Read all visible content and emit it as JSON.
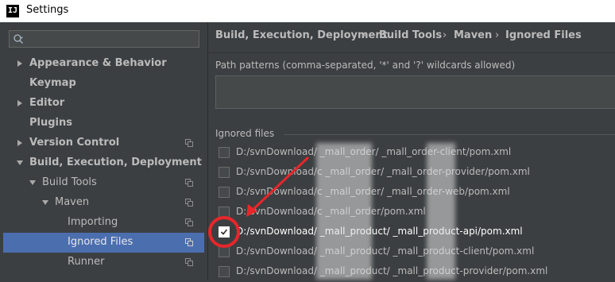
{
  "window": {
    "title": "Settings",
    "app_logo": "IJ"
  },
  "search": {
    "placeholder": "",
    "icon": "search-icon"
  },
  "tree": [
    {
      "label": "Appearance & Behavior",
      "bold": true,
      "arrow": "collapsed",
      "level": 0,
      "has_icon": false,
      "selected": false
    },
    {
      "label": "Keymap",
      "bold": true,
      "arrow": "none",
      "level": 0,
      "has_icon": false,
      "selected": false
    },
    {
      "label": "Editor",
      "bold": true,
      "arrow": "collapsed",
      "level": 0,
      "has_icon": false,
      "selected": false
    },
    {
      "label": "Plugins",
      "bold": true,
      "arrow": "none",
      "level": 0,
      "has_icon": false,
      "selected": false
    },
    {
      "label": "Version Control",
      "bold": true,
      "arrow": "collapsed",
      "level": 0,
      "has_icon": true,
      "selected": false
    },
    {
      "label": "Build, Execution, Deployment",
      "bold": true,
      "arrow": "expanded",
      "level": 0,
      "has_icon": false,
      "selected": false
    },
    {
      "label": "Build Tools",
      "bold": false,
      "arrow": "expanded",
      "level": 1,
      "has_icon": true,
      "selected": false
    },
    {
      "label": "Maven",
      "bold": false,
      "arrow": "expanded",
      "level": 2,
      "has_icon": true,
      "selected": false
    },
    {
      "label": "Importing",
      "bold": false,
      "arrow": "none",
      "level": 3,
      "has_icon": true,
      "selected": false
    },
    {
      "label": "Ignored Files",
      "bold": false,
      "arrow": "none",
      "level": 3,
      "has_icon": true,
      "selected": true
    },
    {
      "label": "Runner",
      "bold": false,
      "arrow": "none",
      "level": 3,
      "has_icon": true,
      "selected": false
    }
  ],
  "breadcrumb": [
    "Build, Execution, Deployment",
    "Build Tools",
    "Maven",
    "Ignored Files"
  ],
  "breadcrumb_separator": "›",
  "path_patterns": {
    "label": "Path patterns (comma-separated, '*' and '?' wildcards allowed)",
    "value": ""
  },
  "ignored_files": {
    "label": "Ignored files",
    "items": [
      {
        "path": "D:/svnDownload/     _mall_order/     _mall_order-client/pom.xml",
        "checked": false
      },
      {
        "path": "D:/svnDownload/c        _mall_order/    _mall_order-provider/pom.xml",
        "checked": false
      },
      {
        "path": "D:/svnDownload/c        _mall_order/     _mall_order-web/pom.xml",
        "checked": false
      },
      {
        "path": "D:/svnDownload/c        _mall_order/pom.xml",
        "checked": false
      },
      {
        "path": "D:/svnDownload/         _mall_product/     _mall_product-api/pom.xml",
        "checked": true
      },
      {
        "path": "D:/svnDownload/         _mall_product/     _mall_product-client/pom.xml",
        "checked": false
      },
      {
        "path": "D:/svnDownload/         _mall_product/     _mall_product-provider/pom.xml",
        "checked": false
      }
    ]
  },
  "colors": {
    "accent_selection": "#4b6eaf",
    "annotation_red": "#e8262a",
    "panel_bg": "#3c3f41",
    "text": "#bbbbbb"
  }
}
